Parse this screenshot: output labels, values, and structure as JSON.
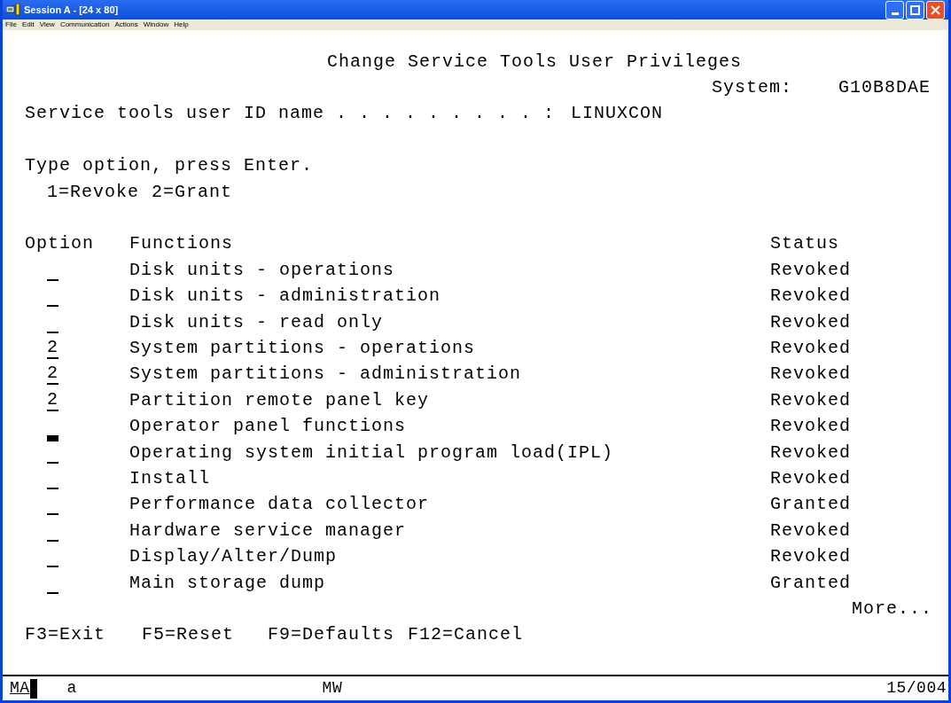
{
  "window": {
    "title": "Session A - [24 x 80]"
  },
  "menu": [
    "File",
    "Edit",
    "View",
    "Communication",
    "Actions",
    "Window",
    "Help"
  ],
  "screen": {
    "title": "Change Service Tools User Privileges",
    "system_label": "System:",
    "system_value": "G10B8DAE",
    "user_id_label": "Service tools user ID name . . . . . . . . . :",
    "user_id_value": "LINUXCON",
    "instruction": "Type option, press Enter.",
    "options": [
      "1=Revoke",
      "2=Grant"
    ],
    "columns": [
      "Option",
      "Functions",
      "Status"
    ],
    "rows": [
      {
        "option": "",
        "cursor": false,
        "function": "Disk units - operations",
        "status": "Revoked"
      },
      {
        "option": "",
        "cursor": false,
        "function": "Disk units - administration",
        "status": "Revoked"
      },
      {
        "option": "",
        "cursor": false,
        "function": "Disk units - read only",
        "status": "Revoked"
      },
      {
        "option": "2",
        "cursor": false,
        "function": "System partitions - operations",
        "status": "Revoked"
      },
      {
        "option": "2",
        "cursor": false,
        "function": "System partitions - administration",
        "status": "Revoked"
      },
      {
        "option": "2",
        "cursor": false,
        "function": "Partition remote panel key",
        "status": "Revoked"
      },
      {
        "option": "",
        "cursor": true,
        "function": "Operator panel functions",
        "status": "Revoked"
      },
      {
        "option": "",
        "cursor": false,
        "function": "Operating system initial program load(IPL)",
        "status": "Revoked"
      },
      {
        "option": "",
        "cursor": false,
        "function": "Install",
        "status": "Revoked"
      },
      {
        "option": "",
        "cursor": false,
        "function": "Performance data collector",
        "status": "Granted"
      },
      {
        "option": "",
        "cursor": false,
        "function": "Hardware service manager",
        "status": "Revoked"
      },
      {
        "option": "",
        "cursor": false,
        "function": "Display/Alter/Dump",
        "status": "Revoked"
      },
      {
        "option": "",
        "cursor": false,
        "function": "Main storage dump",
        "status": "Granted"
      }
    ],
    "more": "More...",
    "function_keys": [
      "F3=Exit",
      "F5=Reset",
      "F9=Defaults",
      "F12=Cancel"
    ]
  },
  "status_bar": {
    "mode": "MA",
    "shift": "a",
    "message": "MW",
    "cursor_position": "15/004"
  }
}
